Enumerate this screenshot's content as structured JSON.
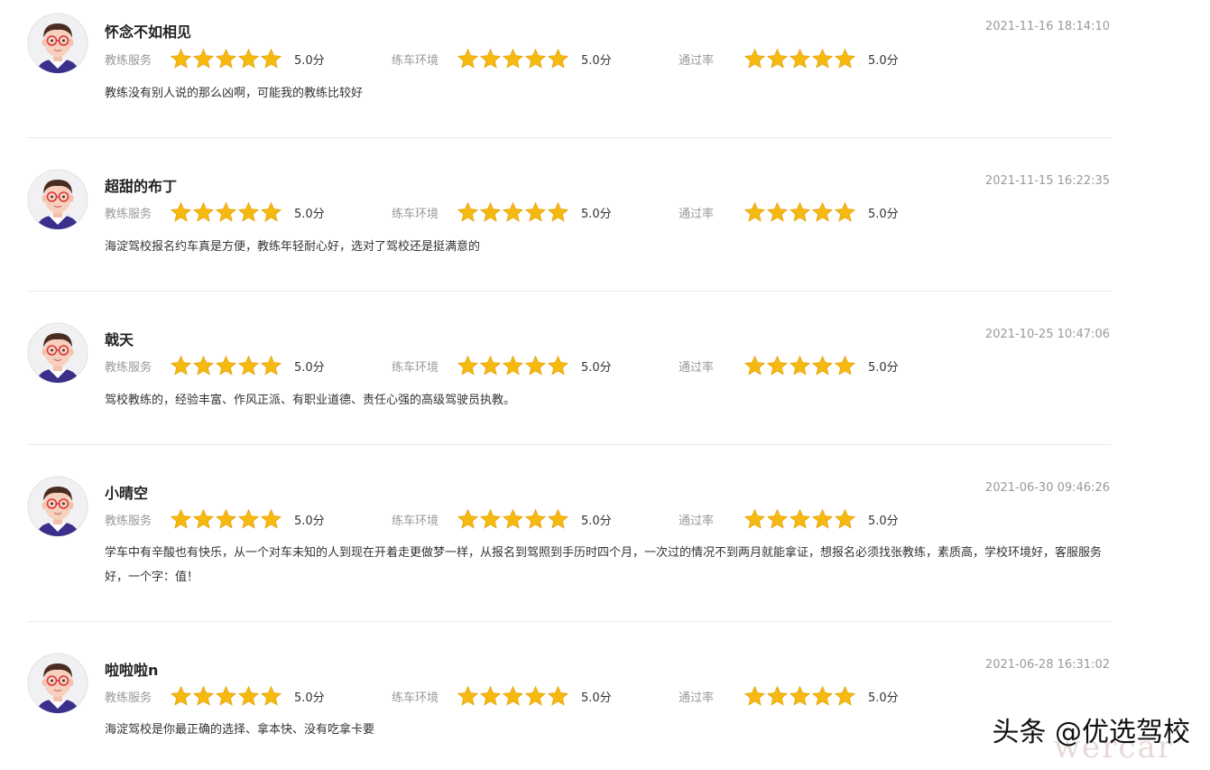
{
  "rating_labels": [
    "教练服务",
    "练车环境",
    "通过率"
  ],
  "star_color": "#f5b90f",
  "reviews": [
    {
      "name": "怀念不如相见",
      "date": "2021-11-16 18:14:10",
      "ratings": [
        {
          "stars": 5,
          "score": "5.0分"
        },
        {
          "stars": 5,
          "score": "5.0分"
        },
        {
          "stars": 5,
          "score": "5.0分"
        }
      ],
      "comment": "教练没有别人说的那么凶啊，可能我的教练比较好"
    },
    {
      "name": "超甜的布丁",
      "date": "2021-11-15 16:22:35",
      "ratings": [
        {
          "stars": 5,
          "score": "5.0分"
        },
        {
          "stars": 5,
          "score": "5.0分"
        },
        {
          "stars": 5,
          "score": "5.0分"
        }
      ],
      "comment": "海淀驾校报名约车真是方便，教练年轻耐心好，选对了驾校还是挺满意的"
    },
    {
      "name": "戟天",
      "date": "2021-10-25 10:47:06",
      "ratings": [
        {
          "stars": 5,
          "score": "5.0分"
        },
        {
          "stars": 5,
          "score": "5.0分"
        },
        {
          "stars": 5,
          "score": "5.0分"
        }
      ],
      "comment": "驾校教练的，经验丰富、作风正派、有职业道德、责任心强的高级驾驶员执教。"
    },
    {
      "name": "小晴空",
      "date": "2021-06-30 09:46:26",
      "ratings": [
        {
          "stars": 5,
          "score": "5.0分"
        },
        {
          "stars": 5,
          "score": "5.0分"
        },
        {
          "stars": 5,
          "score": "5.0分"
        }
      ],
      "comment": "学车中有辛酸也有快乐，从一个对车未知的人到现在开着走更做梦一样，从报名到驾照到手历时四个月，一次过的情况不到两月就能拿证，想报名必须找张教练，素质高，学校环境好，客服服务好，一个字：值！"
    },
    {
      "name": "啦啦啦n",
      "date": "2021-06-28 16:31:02",
      "ratings": [
        {
          "stars": 5,
          "score": "5.0分"
        },
        {
          "stars": 5,
          "score": "5.0分"
        },
        {
          "stars": 5,
          "score": "5.0分"
        }
      ],
      "comment": "海淀驾校是你最正确的选择、拿本快、没有吃拿卡要"
    }
  ],
  "watermark": "头条 @优选驾校",
  "watermark_faint": "wercar"
}
